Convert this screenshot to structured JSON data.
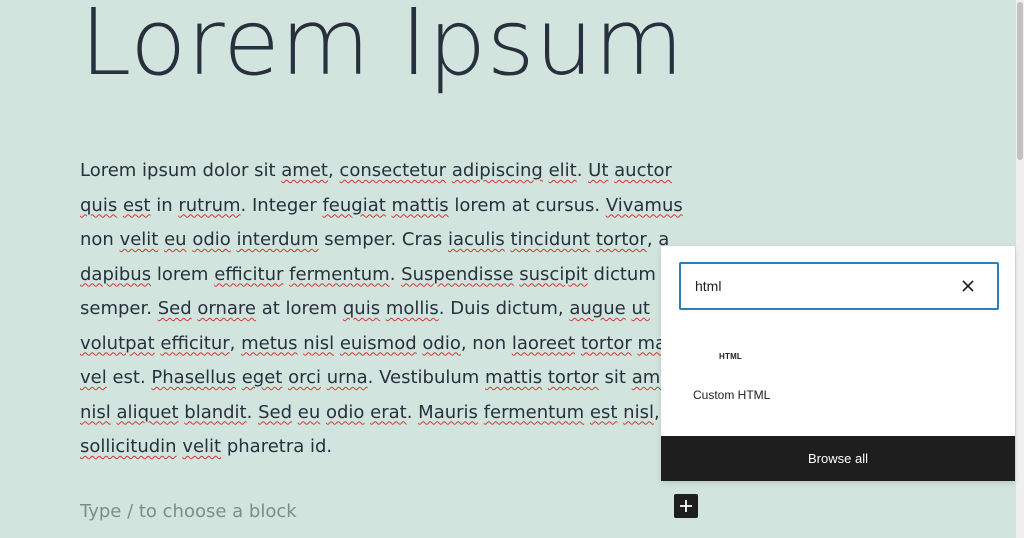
{
  "post": {
    "title": "Lorem Ipsum",
    "paragraph_lines": [
      [
        {
          "t": "Lorem ipsum dolor sit ",
          "s": false
        },
        {
          "t": "amet",
          "s": true
        },
        {
          "t": ", ",
          "s": false
        },
        {
          "t": "consectetur",
          "s": true
        },
        {
          "t": " ",
          "s": false
        },
        {
          "t": "adipiscing",
          "s": true
        },
        {
          "t": " ",
          "s": false
        },
        {
          "t": "elit",
          "s": true
        },
        {
          "t": ". ",
          "s": false
        },
        {
          "t": "Ut",
          "s": true
        },
        {
          "t": " ",
          "s": false
        },
        {
          "t": "auctor",
          "s": true
        }
      ],
      [
        {
          "t": "quis",
          "s": true
        },
        {
          "t": " ",
          "s": false
        },
        {
          "t": "est",
          "s": true
        },
        {
          "t": " in ",
          "s": false
        },
        {
          "t": "rutrum",
          "s": true
        },
        {
          "t": ". Integer ",
          "s": false
        },
        {
          "t": "feugiat",
          "s": true
        },
        {
          "t": " ",
          "s": false
        },
        {
          "t": "mattis",
          "s": true
        },
        {
          "t": " lorem at cursus. ",
          "s": false
        },
        {
          "t": "Vivamus",
          "s": true
        }
      ],
      [
        {
          "t": "non ",
          "s": false
        },
        {
          "t": "velit",
          "s": true
        },
        {
          "t": " ",
          "s": false
        },
        {
          "t": "eu",
          "s": true
        },
        {
          "t": " ",
          "s": false
        },
        {
          "t": "odio",
          "s": true
        },
        {
          "t": " ",
          "s": false
        },
        {
          "t": "interdum",
          "s": true
        },
        {
          "t": " semper. Cras ",
          "s": false
        },
        {
          "t": "iaculis",
          "s": true
        },
        {
          "t": " ",
          "s": false
        },
        {
          "t": "tincidunt",
          "s": true
        },
        {
          "t": " ",
          "s": false
        },
        {
          "t": "tortor",
          "s": true
        },
        {
          "t": ", a",
          "s": false
        }
      ],
      [
        {
          "t": "dapibus",
          "s": true
        },
        {
          "t": " lorem ",
          "s": false
        },
        {
          "t": "efficitur",
          "s": true
        },
        {
          "t": " ",
          "s": false
        },
        {
          "t": "fermentum",
          "s": true
        },
        {
          "t": ". ",
          "s": false
        },
        {
          "t": "Suspendisse",
          "s": true
        },
        {
          "t": " ",
          "s": false
        },
        {
          "t": "suscipit",
          "s": true
        },
        {
          "t": " dictum",
          "s": false
        }
      ],
      [
        {
          "t": "semper. ",
          "s": false
        },
        {
          "t": "Sed",
          "s": true
        },
        {
          "t": " ",
          "s": false
        },
        {
          "t": "ornare",
          "s": true
        },
        {
          "t": " at lorem ",
          "s": false
        },
        {
          "t": "quis",
          "s": true
        },
        {
          "t": " ",
          "s": false
        },
        {
          "t": "mollis",
          "s": true
        },
        {
          "t": ". Duis dictum, ",
          "s": false
        },
        {
          "t": "augue",
          "s": true
        },
        {
          "t": " ",
          "s": false
        },
        {
          "t": "ut",
          "s": true
        }
      ],
      [
        {
          "t": "volutpat",
          "s": true
        },
        {
          "t": " ",
          "s": false
        },
        {
          "t": "efficitur",
          "s": true
        },
        {
          "t": ", ",
          "s": false
        },
        {
          "t": "metus",
          "s": true
        },
        {
          "t": " ",
          "s": false
        },
        {
          "t": "nisl",
          "s": true
        },
        {
          "t": " ",
          "s": false
        },
        {
          "t": "euismod",
          "s": true
        },
        {
          "t": " ",
          "s": false
        },
        {
          "t": "odio",
          "s": true
        },
        {
          "t": ", non ",
          "s": false
        },
        {
          "t": "laoreet",
          "s": true
        },
        {
          "t": " ",
          "s": false
        },
        {
          "t": "tortor",
          "s": true
        },
        {
          "t": " ",
          "s": false
        },
        {
          "t": "ma",
          "s": true
        }
      ],
      [
        {
          "t": "vel",
          "s": true
        },
        {
          "t": " est. ",
          "s": false
        },
        {
          "t": "Phasellus",
          "s": true
        },
        {
          "t": " ",
          "s": false
        },
        {
          "t": "eget",
          "s": true
        },
        {
          "t": " ",
          "s": false
        },
        {
          "t": "orci",
          "s": true
        },
        {
          "t": " ",
          "s": false
        },
        {
          "t": "urna",
          "s": true
        },
        {
          "t": ". Vestibulum ",
          "s": false
        },
        {
          "t": "mattis",
          "s": true
        },
        {
          "t": " ",
          "s": false
        },
        {
          "t": "tortor",
          "s": true
        },
        {
          "t": " sit ",
          "s": false
        },
        {
          "t": "amet",
          "s": true
        }
      ],
      [
        {
          "t": "nisl",
          "s": true
        },
        {
          "t": " ",
          "s": false
        },
        {
          "t": "aliquet",
          "s": true
        },
        {
          "t": " ",
          "s": false
        },
        {
          "t": "blandit",
          "s": true
        },
        {
          "t": ". ",
          "s": false
        },
        {
          "t": "Sed",
          "s": true
        },
        {
          "t": " ",
          "s": false
        },
        {
          "t": "eu",
          "s": true
        },
        {
          "t": " ",
          "s": false
        },
        {
          "t": "odio",
          "s": true
        },
        {
          "t": " ",
          "s": false
        },
        {
          "t": "erat",
          "s": true
        },
        {
          "t": ". ",
          "s": false
        },
        {
          "t": "Mauris",
          "s": true
        },
        {
          "t": " ",
          "s": false
        },
        {
          "t": "fermentum",
          "s": true
        },
        {
          "t": " ",
          "s": false
        },
        {
          "t": "est",
          "s": true
        },
        {
          "t": " ",
          "s": false
        },
        {
          "t": "nisl",
          "s": true
        },
        {
          "t": ", a",
          "s": false
        }
      ],
      [
        {
          "t": "sollicitudin",
          "s": true
        },
        {
          "t": " ",
          "s": false
        },
        {
          "t": "velit",
          "s": true
        },
        {
          "t": " pharetra id.",
          "s": false
        }
      ]
    ],
    "block_placeholder": "Type / to choose a block"
  },
  "inserter": {
    "search_value": "html",
    "clear_icon": "close-icon",
    "results": [
      {
        "icon_text": "HTML",
        "label": "Custom HTML"
      }
    ],
    "browse_all_label": "Browse all"
  },
  "add_block": {
    "icon": "plus-icon"
  },
  "colors": {
    "background": "#d1e4dd",
    "text": "#28303d",
    "focus_border": "#2d7fb6",
    "dark": "#1e1e1e",
    "spellcheck": "#d63638"
  }
}
